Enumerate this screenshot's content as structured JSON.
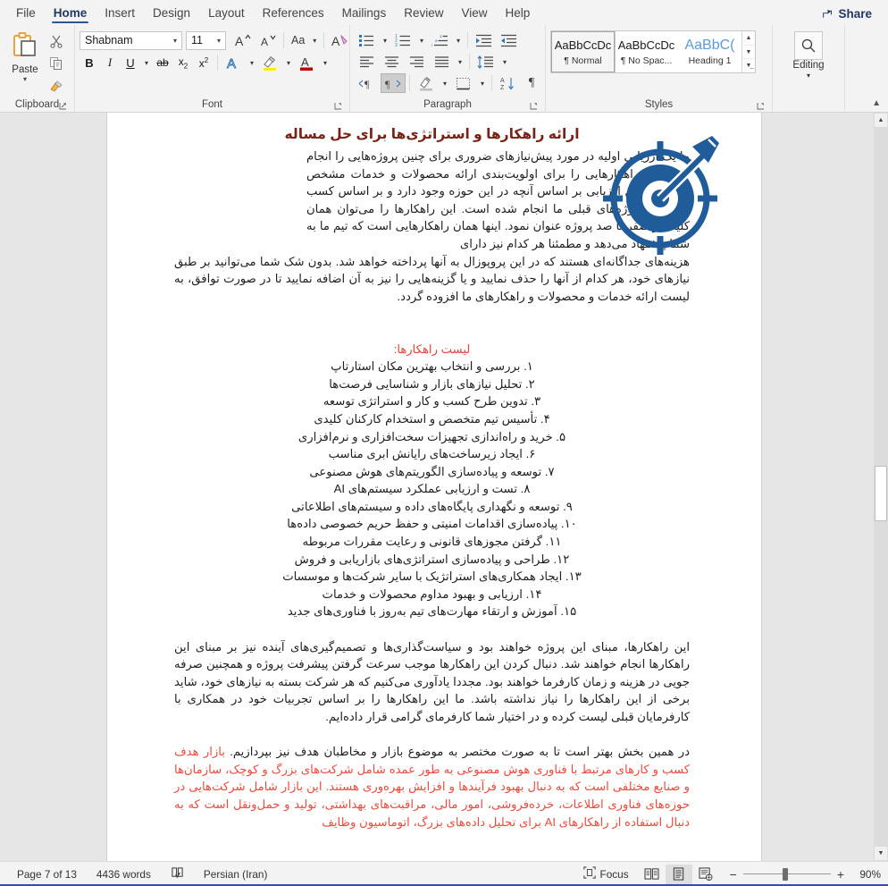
{
  "ribbon": {
    "tabs": [
      {
        "label": "File",
        "active": false
      },
      {
        "label": "Home",
        "active": true
      },
      {
        "label": "Insert",
        "active": false
      },
      {
        "label": "Design",
        "active": false
      },
      {
        "label": "Layout",
        "active": false
      },
      {
        "label": "References",
        "active": false
      },
      {
        "label": "Mailings",
        "active": false
      },
      {
        "label": "Review",
        "active": false
      },
      {
        "label": "View",
        "active": false
      },
      {
        "label": "Help",
        "active": false
      }
    ],
    "share_label": "Share",
    "groups": {
      "clipboard": {
        "label": "Clipboard",
        "paste_label": "Paste",
        "cut_icon": "scissors-icon",
        "copy_icon": "copy-icon",
        "format_painter_icon": "format-painter-icon"
      },
      "font": {
        "label": "Font",
        "font_name": "Shabnam",
        "font_size": "11",
        "grow_font": "A",
        "shrink_font": "A",
        "change_case": "Aa",
        "clear_formatting_icon": "clear-formatting-icon",
        "bold": "B",
        "italic": "I",
        "underline": "U",
        "strikethrough": "ab",
        "subscript": "x",
        "superscript": "x",
        "text_effects_icon": "text-effects-icon",
        "highlight_icon": "text-highlight-icon",
        "font_color_icon": "font-color-icon"
      },
      "paragraph": {
        "label": "Paragraph",
        "bullets_icon": "bullet-list-icon",
        "numbering_icon": "numbered-list-icon",
        "multilevel_icon": "multilevel-list-icon",
        "decrease_indent_icon": "decrease-indent-icon",
        "increase_indent_icon": "increase-indent-icon",
        "align_left_icon": "align-left-icon",
        "align_center_icon": "align-center-icon",
        "align_right_icon": "align-right-icon",
        "justify_icon": "justify-icon",
        "line_spacing_icon": "line-spacing-icon",
        "ltr_icon": "left-to-right-icon",
        "rtl_icon": "right-to-left-icon",
        "shading_icon": "shading-icon",
        "borders_icon": "borders-icon",
        "sort_icon": "sort-icon",
        "show_marks_icon": "show-formatting-marks-icon"
      },
      "styles": {
        "label": "Styles",
        "items": [
          {
            "preview": "AaBbCcDc",
            "name": "¶ Normal",
            "selected": true,
            "heading": false
          },
          {
            "preview": "AaBbCcDc",
            "name": "¶ No Spac...",
            "selected": false,
            "heading": false
          },
          {
            "preview": "AaBbC(",
            "name": "Heading 1",
            "selected": false,
            "heading": true
          }
        ]
      },
      "editing": {
        "label": "Editing",
        "button_label": "Editing",
        "icon": "search-icon"
      }
    }
  },
  "document": {
    "title": "ارائه راهکارها و استراتژی‌ها برای حل مساله",
    "image_alt": "target-dartboard-icon",
    "paragraph1": "ما یک ارزیابی اولیه در مورد پیش‌نیازهای ضروری برای چنین پروژه‌هایی را انجام داده‌ایم و راهکارهایی را برای اولویت‌بندی ارائه محصولات و خدمات مشخص نموده‌ایم. این ارزیابی بر اساس آنچه در این حوزه وجود دارد و بر اساس کسب تجربه از پروژه‌های قبلی ما انجام شده است. این راهکارها را می‌توان همان کلیات و صفر تا صد پروژه عنوان نمود. اینها همان راهکارهایی است که تیم ما به شما پیشنهاد می‌دهد و مطمئنا هر کدام نیز دارای",
    "paragraph1_cont": "هزینه‌های جداگانه‌ای هستند که در این پروپوزال به آنها پرداخته خواهد شد. بدون شک شما می‌توانید بر طبق نیازهای خود، هر کدام از آنها را حذف نمایید و یا گزینه‌هایی را نیز به آن اضافه نمایید تا در صورت توافق، به لیست ارائه خدمات و محصولات و راهکارهای ما افزوده گردد.",
    "list_heading": "لیست راهکارها:",
    "list_items": [
      "۱. بررسی و انتخاب بهترین مکان استارتاپ",
      "۲. تحلیل نیازهای بازار و شناسایی فرصت‌ها",
      "۳. تدوین طرح کسب و کار و استراتژی توسعه",
      "۴. تأسیس تیم متخصص و استخدام کارکنان کلیدی",
      "۵. خرید و راه‌اندازی تجهیزات سخت‌افزاری و نرم‌افزاری",
      "۶. ایجاد زیرساخت‌های رایانش ابری مناسب",
      "۷. توسعه و پیاده‌سازی الگوریتم‌های هوش مصنوعی",
      "۸. تست و ارزیابی عملکرد سیستم‌های AI",
      "۹. توسعه و نگهداری پایگاه‌های داده و سیستم‌های اطلاعاتی",
      "۱۰. پیاده‌سازی اقدامات امنیتی و حفظ حریم خصوصی داده‌ها",
      "۱۱. گرفتن مجوزهای قانونی و رعایت مقررات مربوطه",
      "۱۲. طراحی و پیاده‌سازی استراتژی‌های بازاریابی و فروش",
      "۱۳. ایجاد همکاری‌های استراتژیک با سایر شرکت‌ها و موسسات",
      "۱۴. ارزیابی و بهبود مداوم محصولات و خدمات",
      "۱۵. آموزش و ارتقاء مهارت‌های تیم به‌روز با فناوری‌های جدید"
    ],
    "paragraph2": "این راهکارها، مبنای این پروژه خواهند بود و سیاست‌گذاری‌ها و تصمیم‌گیری‌های آینده نیز بر مبنای این راهکارها انجام خواهند شد. دنبال کردن این راهکارها موجب سرعت گرفتن پیشرفت پروژه و همچنین صرفه جویی در هزینه و زمان کارفرما خواهند بود. مجددا یادآوری می‌کنیم که هر شرکت بسته به نیازهای خود، شاید برخی از این راهکارها را نیاز نداشته باشد. ما این راهکارها را بر اساس تجربیات خود در همکاری با کارفرمایان قبلی لیست کرده و در اختیار شما کارفرمای گرامی قرار داده‌ایم.",
    "paragraph3_black": "در همین بخش بهتر است تا به صورت مختصر به موضوع بازار و مخاطبان هدف نیز بپردازیم. ",
    "paragraph3_red": "بازار هدف کسب و کارهای مرتبط با فناوری هوش مصنوعی به طور عمده شامل شرکت‌های بزرگ و کوچک، سازمان‌ها و صنایع مختلفی است که به دنبال بهبود فرآیندها و افزایش بهره‌وری هستند. این بازار شامل شرکت‌هایی در حوزه‌های فناوری اطلاعات، خرده‌فروشی، امور مالی، مراقبت‌های بهداشتی، تولید و حمل‌ونقل است که به دنبال استفاده از راهکارهای AI برای تحلیل داده‌های بزرگ، اتوماسیون وظایف"
  },
  "statusbar": {
    "page": "Page 7 of 13",
    "words": "4436 words",
    "proofing_icon": "proofing-errors-icon",
    "language": "Persian (Iran)",
    "focus_label": "Focus",
    "read_mode_icon": "read-mode-icon",
    "print_layout_icon": "print-layout-icon",
    "web_layout_icon": "web-layout-icon",
    "zoom_out": "−",
    "zoom_in": "+",
    "zoom_level": "90%"
  },
  "colors": {
    "accent": "#2b579a",
    "title_red": "#7b2216",
    "list_red": "#e8453c",
    "paragraph_red": "#ee4a3d",
    "target_blue": "#1f5c99"
  }
}
